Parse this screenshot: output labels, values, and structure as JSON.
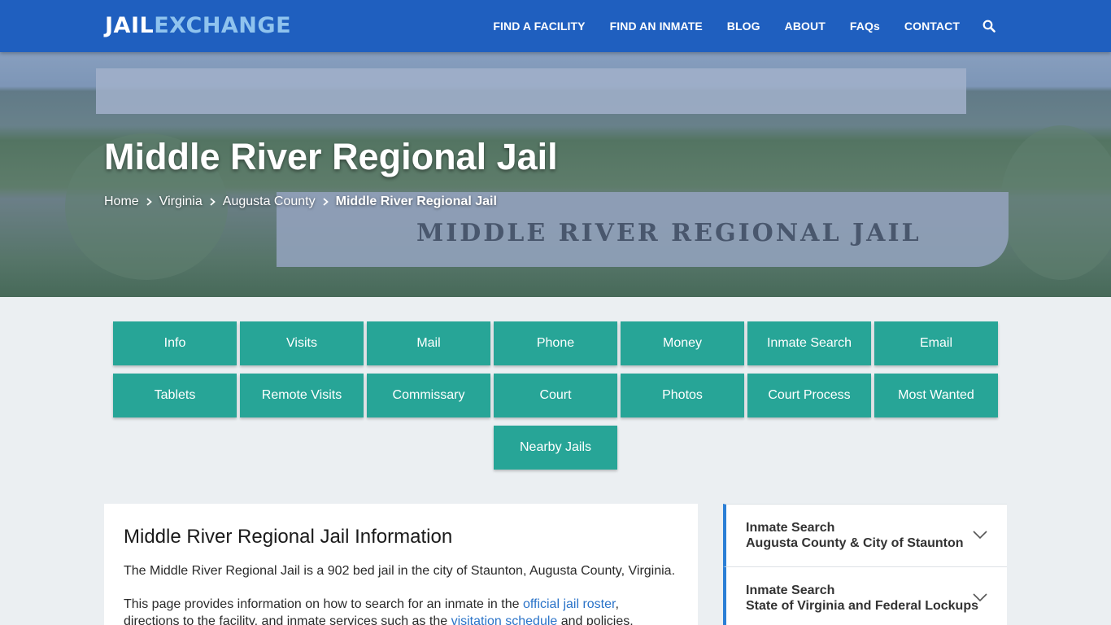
{
  "header": {
    "logo_part1": "JAIL",
    "logo_part2": "EXCHANGE",
    "nav": [
      "FIND A FACILITY",
      "FIND AN INMATE",
      "BLOG",
      "ABOUT",
      "FAQs",
      "CONTACT"
    ],
    "search_icon": "search-icon",
    "bg_color": "#1f5fbf"
  },
  "hero": {
    "title": "Middle River Regional Jail",
    "sign_text": "MIDDLE RIVER REGIONAL JAIL",
    "breadcrumb": [
      "Home",
      "Virginia",
      "Augusta County",
      "Middle River Regional Jail"
    ]
  },
  "buttons": {
    "row1": [
      "Info",
      "Visits",
      "Mail",
      "Phone",
      "Money",
      "Inmate Search",
      "Email"
    ],
    "row2": [
      "Tablets",
      "Remote Visits",
      "Commissary",
      "Court",
      "Photos",
      "Court Process",
      "Most Wanted"
    ],
    "row3": [
      "Nearby Jails"
    ],
    "color": "#27a597"
  },
  "info": {
    "heading": "Middle River Regional Jail Information",
    "p1": "The Middle River Regional Jail is a 902 bed jail in the city of Staunton, Augusta County, Virginia.",
    "p2_a": "This page provides information on how to search for an inmate in the ",
    "p2_link1": "official jail roster",
    "p2_b": ",",
    "p2_c": "directions to the facility, and inmate services such as the ",
    "p2_link2": "visitation schedule",
    "p2_d": " and policies."
  },
  "sidebar": {
    "items": [
      {
        "line1": "Inmate Search",
        "line2": "Augusta County & City of Staunton"
      },
      {
        "line1": "Inmate Search",
        "line2": "State of Virginia and Federal Lockups"
      }
    ],
    "accent": "#2b7fd6"
  }
}
